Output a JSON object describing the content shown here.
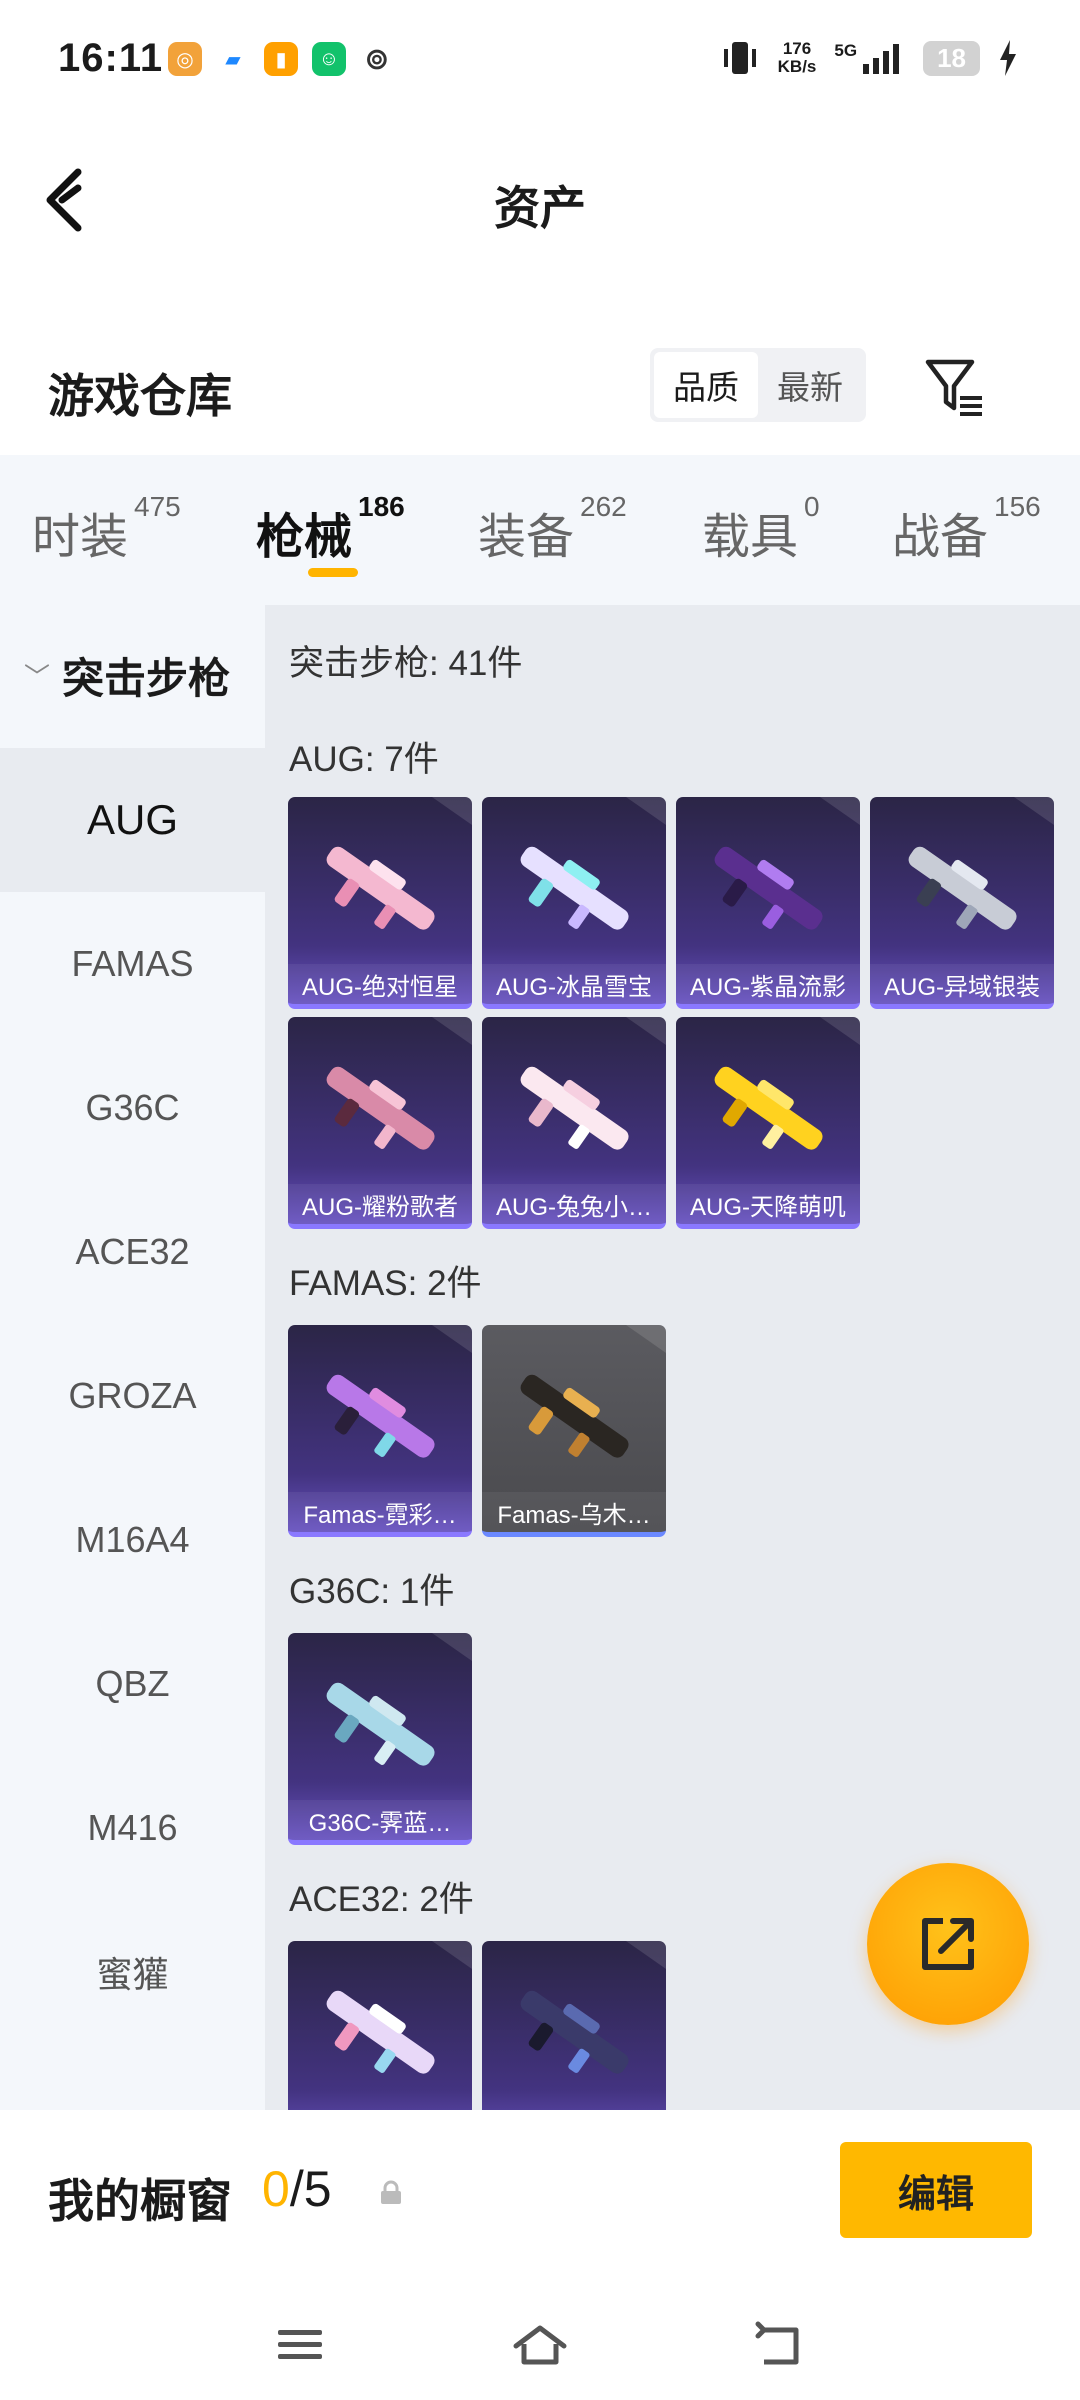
{
  "status_bar": {
    "time": "16:11",
    "net_speed": "176",
    "net_unit": "KB/s",
    "signal": "5G",
    "battery": "18"
  },
  "header": {
    "title": "资产"
  },
  "warehouse": {
    "title": "游戏仓库",
    "sort_options": [
      "品质",
      "最新"
    ],
    "sort_selected": "品质"
  },
  "tabs": [
    {
      "label": "时装",
      "count": "475"
    },
    {
      "label": "枪械",
      "count": "186"
    },
    {
      "label": "装备",
      "count": "262"
    },
    {
      "label": "载具",
      "count": "0"
    },
    {
      "label": "战备",
      "count": "156"
    }
  ],
  "active_tab": "枪械",
  "sidebar": {
    "category": "突击步枪",
    "items": [
      "AUG",
      "FAMAS",
      "G36C",
      "ACE32",
      "GROZA",
      "M16A4",
      "QBZ",
      "M416",
      "蜜獾"
    ],
    "selected": "AUG"
  },
  "content": {
    "total": "突击步枪: 41件",
    "groups": [
      {
        "title": "AUG: 7件",
        "items": [
          "AUG-绝对恒星",
          "AUG-冰晶雪宝",
          "AUG-紫晶流影",
          "AUG-异域银装",
          "AUG-耀粉歌者",
          "AUG-兔兔小…",
          "AUG-天降萌叽"
        ]
      },
      {
        "title": "FAMAS: 2件",
        "items": [
          "Famas-霓彩…",
          "Famas-乌木…"
        ]
      },
      {
        "title": "G36C: 1件",
        "items": [
          "G36C-霁蓝…"
        ]
      },
      {
        "title": "ACE32: 2件",
        "items": [
          "",
          ""
        ]
      }
    ]
  },
  "showcase": {
    "label": "我的橱窗",
    "count": "0",
    "total": "/5",
    "edit_label": "编辑"
  },
  "colors": {
    "accent": "#ffb400",
    "card_purple": "#433380",
    "card_gray": "#4a4a4e"
  },
  "icons": [
    "back-arrow-icon",
    "filter-icon",
    "chevron-down-icon",
    "share-icon",
    "lock-icon",
    "menu-icon",
    "home-icon",
    "back-icon"
  ]
}
